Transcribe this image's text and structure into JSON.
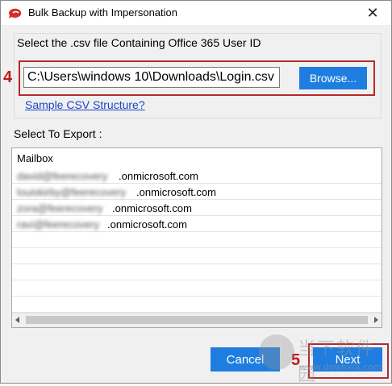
{
  "window": {
    "title": "Bulk Backup with Impersonation",
    "close_glyph": "✕"
  },
  "csv_section": {
    "label": "Select the .csv file Containing Office 365 User ID",
    "path_value": "C:\\Users\\windows 10\\Downloads\\Login.csv",
    "browse_label": "Browse...",
    "sample_link": "Sample CSV Structure?"
  },
  "export_section": {
    "label": "Select To Export :",
    "column_header": "Mailbox",
    "rows": [
      {
        "local": "david@feerecovery",
        "domain": ".onmicrosoft.com"
      },
      {
        "local": "louiskirby@feerecovery",
        "domain": ".onmicrosoft.com"
      },
      {
        "local": "zora@feerecovery",
        "domain": ".onmicrosoft.com"
      },
      {
        "local": "ravi@feerecovery",
        "domain": ".onmicrosoft.com"
      }
    ]
  },
  "buttons": {
    "cancel_label": "Cancel",
    "next_label": "Next"
  },
  "annotations": {
    "step4": "4",
    "step5": "5",
    "color": "#c01818"
  },
  "watermark": {
    "title": "当下软件园",
    "url": "www.downxia.com"
  },
  "colors": {
    "button_blue": "#1f7de0",
    "link_blue": "#1a44cc"
  }
}
